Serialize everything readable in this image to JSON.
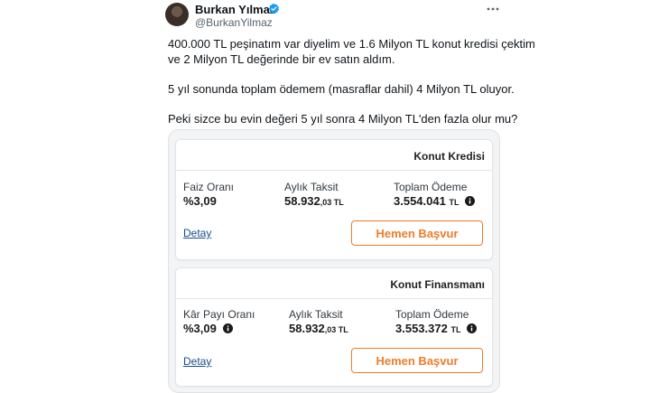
{
  "author": {
    "name": "Burkan Yılmaz",
    "handle": "@BurkanYilmaz",
    "verified_color": "#1d9bf0"
  },
  "tweet": {
    "line1": "400.000 TL peşinatım var diyelim ve 1.6 Milyon TL konut kredisi çektim",
    "line2": "ve 2 Milyon TL değerinde bir ev satın aldım.",
    "line3": "5 yıl sonunda toplam ödemem (masraflar dahil) 4 Milyon TL oluyor.",
    "line4": "Peki sizce bu evin değeri 5 yıl sonra 4 Milyon TL'den fazla olur mu?"
  },
  "cards": [
    {
      "title": "Konut Kredisi",
      "rate_label": "Faiz Oranı",
      "rate_value": "%3,09",
      "monthly_label": "Aylık Taksit",
      "monthly_main": "58.932",
      "monthly_cents": ",03 TL",
      "total_label": "Toplam Ödeme",
      "total_main": "3.554.041",
      "total_unit": "TL",
      "detail_link": "Detay",
      "apply_button": "Hemen Başvur"
    },
    {
      "title": "Konut Finansmanı",
      "rate_label": "Kâr Payı Oranı",
      "rate_value": "%3,09",
      "monthly_label": "Aylık Taksit",
      "monthly_main": "58.932",
      "monthly_cents": ",03 TL",
      "total_label": "Toplam Ödeme",
      "total_main": "3.553.372",
      "total_unit": "TL",
      "detail_link": "Detay",
      "apply_button": "Hemen Başvur"
    }
  ],
  "icons": {
    "verified": "verified-badge-icon",
    "more": "more-options-icon",
    "info": "info-icon"
  },
  "colors": {
    "accent_orange": "#f07c29",
    "link_blue": "#1a4d8f"
  }
}
